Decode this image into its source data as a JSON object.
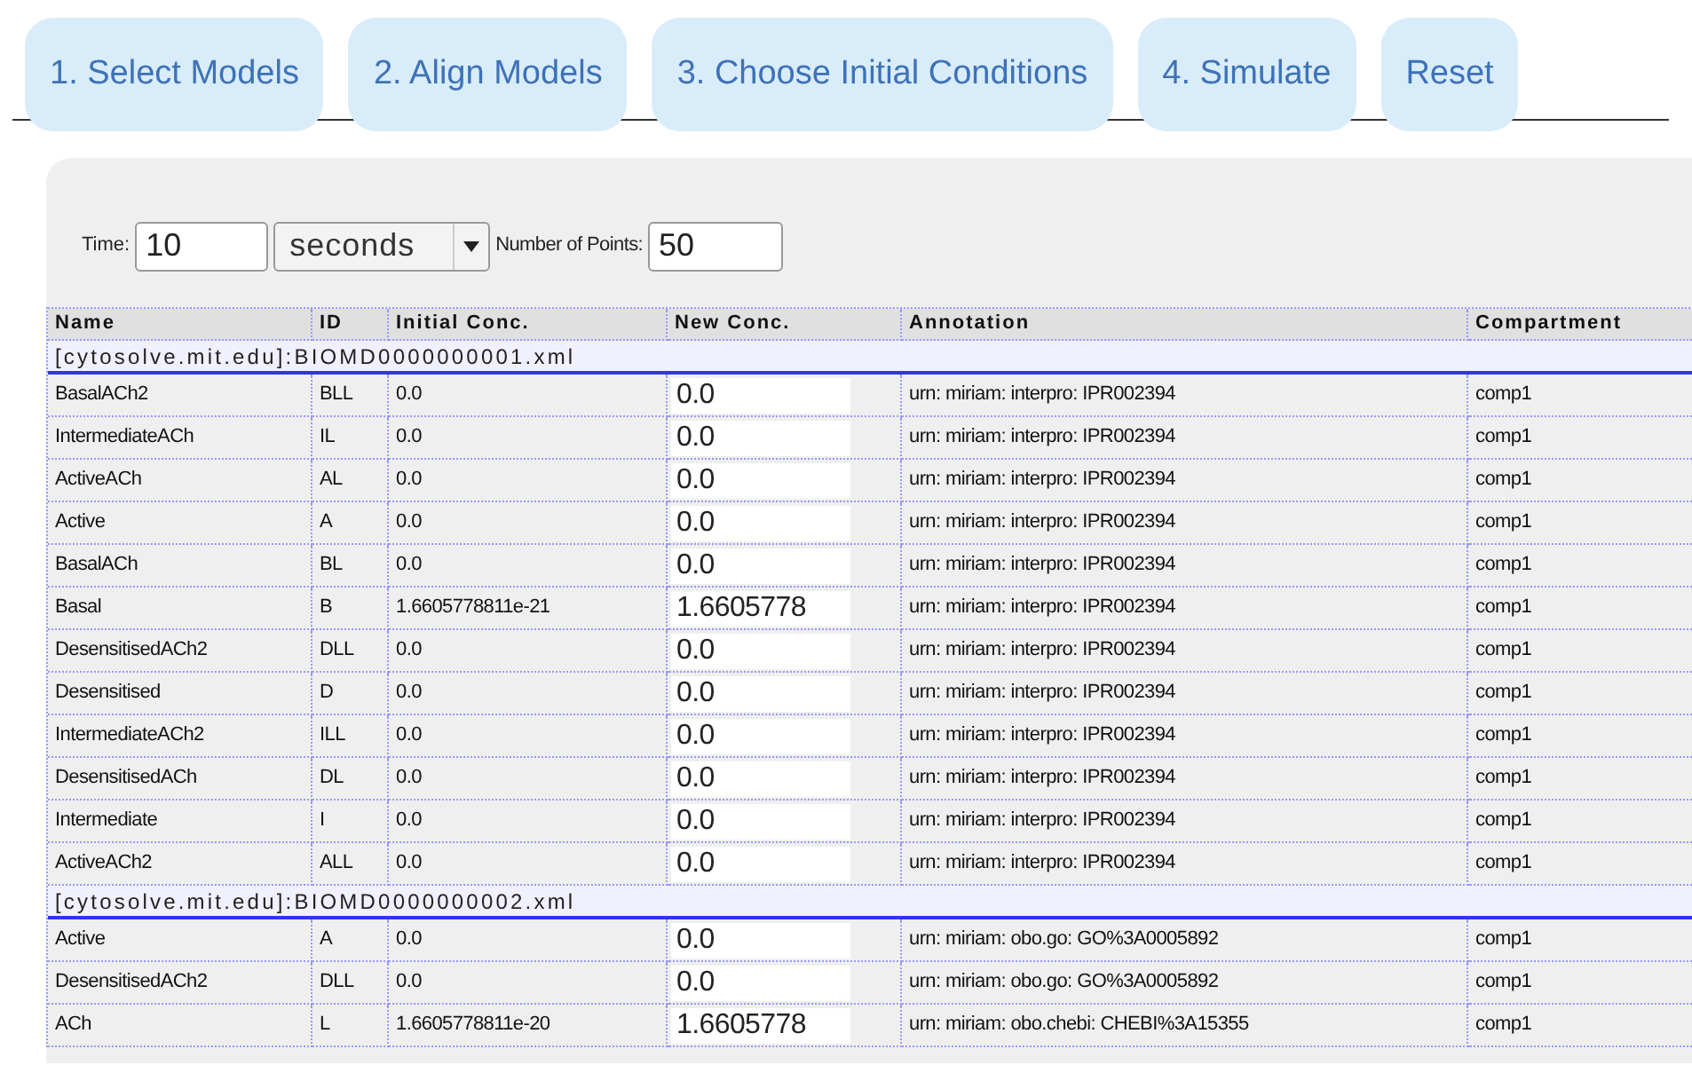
{
  "nav_buttons": [
    "1. Select Models",
    "2. Align Models",
    "3. Choose Initial Conditions",
    "4. Simulate",
    "Reset"
  ],
  "controls": {
    "time_label": "Time:",
    "time_value": "10",
    "unit": "seconds",
    "points_label": "Number of Points:",
    "points_value": "50"
  },
  "table": {
    "columns": [
      "Name",
      "ID",
      "Initial Conc.",
      "New Conc.",
      "Annotation",
      "Compartment"
    ],
    "groups": [
      {
        "title": "[cytosolve.mit.edu]:BIOMD0000000001.xml",
        "rows": [
          {
            "name": "BasalACh2",
            "id": "BLL",
            "initial": "0.0",
            "new": "0.0",
            "annotation": "urn: miriam: interpro: IPR002394",
            "compartment": "comp1"
          },
          {
            "name": "IntermediateACh",
            "id": "IL",
            "initial": "0.0",
            "new": "0.0",
            "annotation": "urn: miriam: interpro: IPR002394",
            "compartment": "comp1"
          },
          {
            "name": "ActiveACh",
            "id": "AL",
            "initial": "0.0",
            "new": "0.0",
            "annotation": "urn: miriam: interpro: IPR002394",
            "compartment": "comp1"
          },
          {
            "name": "Active",
            "id": "A",
            "initial": "0.0",
            "new": "0.0",
            "annotation": "urn: miriam: interpro: IPR002394",
            "compartment": "comp1"
          },
          {
            "name": "BasalACh",
            "id": "BL",
            "initial": "0.0",
            "new": "0.0",
            "annotation": "urn: miriam: interpro: IPR002394",
            "compartment": "comp1"
          },
          {
            "name": "Basal",
            "id": "B",
            "initial": "1.6605778811e-21",
            "new": "1.6605778",
            "annotation": "urn: miriam: interpro: IPR002394",
            "compartment": "comp1"
          },
          {
            "name": "DesensitisedACh2",
            "id": "DLL",
            "initial": "0.0",
            "new": "0.0",
            "annotation": "urn: miriam: interpro: IPR002394",
            "compartment": "comp1"
          },
          {
            "name": "Desensitised",
            "id": "D",
            "initial": "0.0",
            "new": "0.0",
            "annotation": "urn: miriam: interpro: IPR002394",
            "compartment": "comp1"
          },
          {
            "name": "IntermediateACh2",
            "id": "ILL",
            "initial": "0.0",
            "new": "0.0",
            "annotation": "urn: miriam: interpro: IPR002394",
            "compartment": "comp1"
          },
          {
            "name": "DesensitisedACh",
            "id": "DL",
            "initial": "0.0",
            "new": "0.0",
            "annotation": "urn: miriam: interpro: IPR002394",
            "compartment": "comp1"
          },
          {
            "name": "Intermediate",
            "id": "I",
            "initial": "0.0",
            "new": "0.0",
            "annotation": "urn: miriam: interpro: IPR002394",
            "compartment": "comp1"
          },
          {
            "name": "ActiveACh2",
            "id": "ALL",
            "initial": "0.0",
            "new": "0.0",
            "annotation": "urn: miriam: interpro: IPR002394",
            "compartment": "comp1"
          }
        ]
      },
      {
        "title": "[cytosolve.mit.edu]:BIOMD0000000002.xml",
        "rows": [
          {
            "name": "Active",
            "id": "A",
            "initial": "0.0",
            "new": "0.0",
            "annotation": "urn: miriam: obo.go: GO%3A0005892",
            "compartment": "comp1"
          },
          {
            "name": "DesensitisedACh2",
            "id": "DLL",
            "initial": "0.0",
            "new": "0.0",
            "annotation": "urn: miriam: obo.go: GO%3A0005892",
            "compartment": "comp1"
          },
          {
            "name": "ACh",
            "id": "L",
            "initial": "1.6605778811e-20",
            "new": "1.6605778",
            "annotation": "urn: miriam: obo.chebi: CHEBI%3A15355",
            "compartment": "comp1"
          }
        ]
      }
    ]
  }
}
